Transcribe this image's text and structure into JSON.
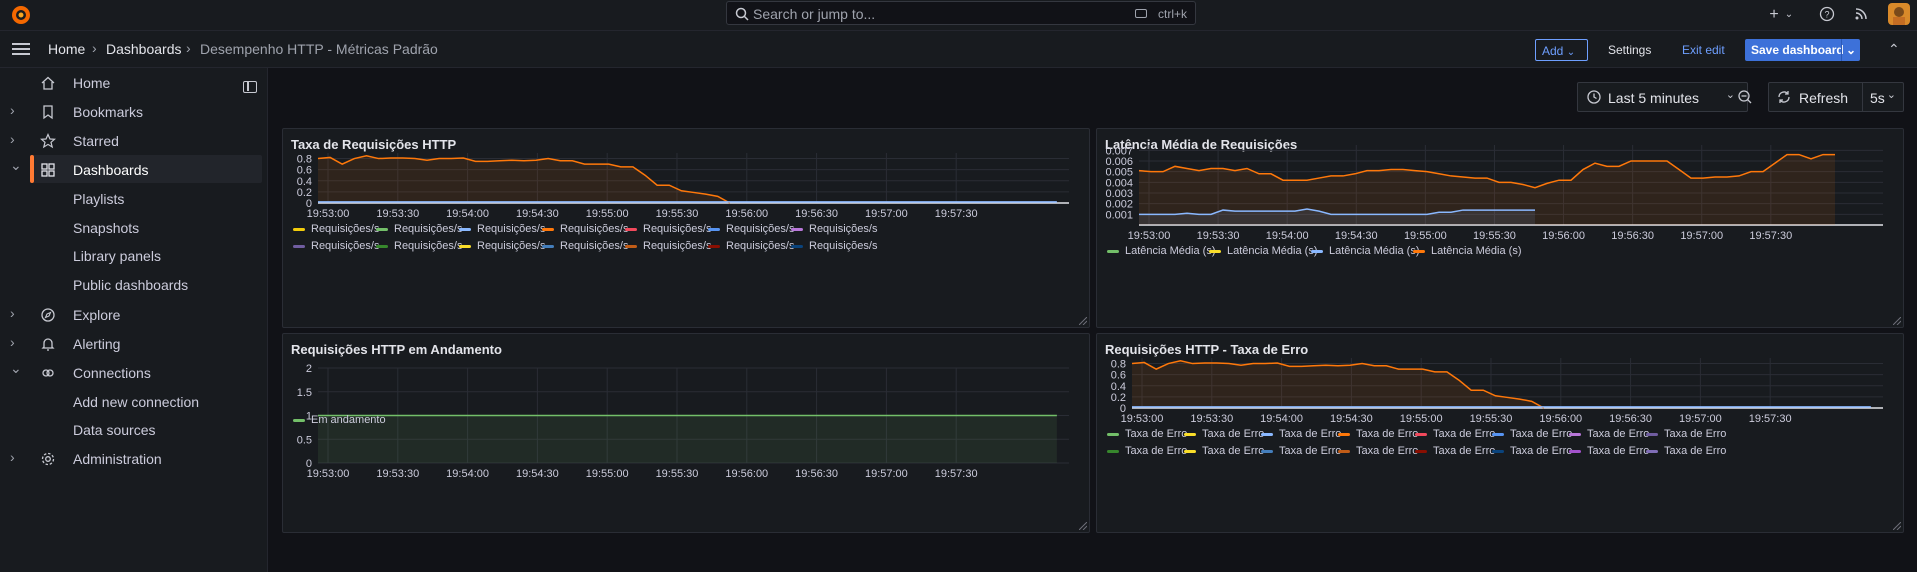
{
  "topbar": {
    "search_placeholder": "Search or jump to...",
    "search_shortcut": "ctrl+k",
    "icons": [
      "plus-icon",
      "help-icon",
      "news-icon",
      "avatar"
    ]
  },
  "breadcrumb": {
    "home": "Home",
    "dashboards": "Dashboards",
    "current": "Desempenho HTTP - Métricas Padrão"
  },
  "toolbar": {
    "add_label": "Add",
    "settings_label": "Settings",
    "exit_edit_label": "Exit edit",
    "save_label": "Save dashboard"
  },
  "sidebar": {
    "items": [
      {
        "label": "Home",
        "icon": "home-icon",
        "chevron": ""
      },
      {
        "label": "Bookmarks",
        "icon": "bookmark-icon",
        "chevron": "›"
      },
      {
        "label": "Starred",
        "icon": "star-icon",
        "chevron": "›"
      },
      {
        "label": "Dashboards",
        "icon": "apps-icon",
        "chevron": "⌄",
        "active": true
      },
      {
        "label": "Playlists",
        "sub": true
      },
      {
        "label": "Snapshots",
        "sub": true
      },
      {
        "label": "Library panels",
        "sub": true
      },
      {
        "label": "Public dashboards",
        "sub": true
      },
      {
        "label": "Explore",
        "icon": "compass-icon",
        "chevron": "›"
      },
      {
        "label": "Alerting",
        "icon": "bell-icon",
        "chevron": "›"
      },
      {
        "label": "Connections",
        "icon": "link-icon",
        "chevron": "⌄"
      },
      {
        "label": "Add new connection",
        "sub": true
      },
      {
        "label": "Data sources",
        "sub": true
      },
      {
        "label": "Administration",
        "icon": "cog-icon",
        "chevron": "›"
      }
    ]
  },
  "controls": {
    "time_range": "Last 5 minutes",
    "refresh_label": "Refresh",
    "refresh_interval": "5s"
  },
  "colors": {
    "orange": "#ff780a",
    "green": "#73bf69",
    "blue": "#8ab8ff",
    "accent": "#3d71d9"
  },
  "panels": {
    "p1": {
      "title": "Taxa de Requisições HTTP"
    },
    "p2": {
      "title": "Latência Média de Requisições"
    },
    "p3": {
      "title": "Requisições HTTP em Andamento"
    },
    "p4": {
      "title": "Requisições HTTP - Taxa de Erro"
    }
  },
  "chart_data": [
    {
      "type": "area",
      "title": "Taxa de Requisições HTTP",
      "x_ticks": [
        "19:53:00",
        "19:53:30",
        "19:54:00",
        "19:54:30",
        "19:55:00",
        "19:55:30",
        "19:56:00",
        "19:56:30",
        "19:57:00",
        "19:57:30"
      ],
      "y_ticks": [
        "0",
        "0.2",
        "0.4",
        "0.6",
        "0.8"
      ],
      "ylim": [
        0,
        0.9
      ],
      "series": [
        {
          "name": "Requisições/s",
          "color": "#ff780a",
          "values": [
            0.8,
            0.82,
            0.7,
            0.8,
            0.85,
            0.8,
            0.81,
            0.81,
            0.8,
            0.77,
            0.8,
            0.8,
            0.81,
            0.75,
            0.75,
            0.76,
            0.77,
            0.76,
            0.77,
            0.8,
            0.76,
            0.76,
            0.7,
            0.7,
            0.7,
            0.65,
            0.65,
            0.5,
            0.32,
            0.32,
            0.22,
            0.19,
            0.16,
            0.12,
            0
          ]
        },
        {
          "name": "Requisições/s",
          "color": "#8ab8ff",
          "values": [
            0.02,
            0.02,
            0.02,
            0.02,
            0.02,
            0.02,
            0.02,
            0.02,
            0.02,
            0.02,
            0.02,
            0.02,
            0.02,
            0.02,
            0.02,
            0.02,
            0.02,
            0.02,
            0.02,
            0.02,
            0.02,
            0.02,
            0.02,
            0.02,
            0.02,
            0.02,
            0.02,
            0.02,
            0.02,
            0.02,
            0.02,
            0.02,
            0.02,
            0.02,
            0.02,
            0.02,
            0.02,
            0.02,
            0.02,
            0.02,
            0.02,
            0.02,
            0.02,
            0.02,
            0.02,
            0.02,
            0.02,
            0.02,
            0.02,
            0.02,
            0.02,
            0.02,
            0.02,
            0.02,
            0.02,
            0.02,
            0.02,
            0.02,
            0.02,
            0.02,
            0.02,
            0.02
          ]
        }
      ],
      "legend": {
        "row1": [
          {
            "name": "Requisições/s",
            "color": "#f2cc0c"
          },
          {
            "name": "Requisições/s",
            "color": "#73bf69"
          },
          {
            "name": "Requisições/s",
            "color": "#8ab8ff"
          },
          {
            "name": "Requisições/s",
            "color": "#ff780a"
          },
          {
            "name": "Requisições/s",
            "color": "#f2495c"
          },
          {
            "name": "Requisições/s",
            "color": "#5794f2"
          },
          {
            "name": "Requisições/s",
            "color": "#b877d9"
          }
        ],
        "row2": [
          {
            "name": "Requisições/s",
            "color": "#705da0"
          },
          {
            "name": "Requisições/s",
            "color": "#37872d"
          },
          {
            "name": "Requisições/s",
            "color": "#fade2a"
          },
          {
            "name": "Requisições/s",
            "color": "#447ebc"
          },
          {
            "name": "Requisições/s",
            "color": "#c15c17"
          },
          {
            "name": "Requisições/s",
            "color": "#890f02"
          },
          {
            "name": "Requisições/s",
            "color": "#0a437c"
          }
        ]
      }
    },
    {
      "type": "area",
      "title": "Latência Média de Requisições",
      "x_ticks": [
        "19:53:00",
        "19:53:30",
        "19:54:00",
        "19:54:30",
        "19:55:00",
        "19:55:30",
        "19:56:00",
        "19:56:30",
        "19:57:00",
        "19:57:30"
      ],
      "y_ticks": [
        "0.001",
        "0.002",
        "0.003",
        "0.004",
        "0.005",
        "0.006",
        "0.007"
      ],
      "ylim": [
        0,
        0.0075
      ],
      "series": [
        {
          "name": "Latência Média (s)",
          "color": "#ff780a",
          "values": [
            0.0051,
            0.005,
            0.005,
            0.0055,
            0.0053,
            0.0051,
            0.0053,
            0.0053,
            0.0051,
            0.0053,
            0.0048,
            0.0048,
            0.0042,
            0.0042,
            0.0042,
            0.0044,
            0.0046,
            0.0046,
            0.0048,
            0.0051,
            0.0051,
            0.0052,
            0.0052,
            0.0051,
            0.005,
            0.0048,
            0.0046,
            0.0045,
            0.0044,
            0.0044,
            0.004,
            0.004,
            0.0038,
            0.0035,
            0.0039,
            0.0042,
            0.0042,
            0.0052,
            0.0058,
            0.0055,
            0.0055,
            0.006,
            0.006,
            0.006,
            0.006,
            0.0052,
            0.0044,
            0.0044,
            0.0045,
            0.0045,
            0.0046,
            0.005,
            0.005,
            0.0058,
            0.0066,
            0.0066,
            0.0062,
            0.0066,
            0.0066
          ]
        },
        {
          "name": "Latência Média (s)",
          "color": "#8ab8ff",
          "values": [
            0.001,
            0.001,
            0.001,
            0.001,
            0.0011,
            0.001,
            0.001,
            0.0014,
            0.0013,
            0.0013,
            0.0013,
            0.0013,
            0.0013,
            0.0013,
            0.0015,
            0.0013,
            0.001,
            0.001,
            0.001,
            0.001,
            0.001,
            0.001,
            0.001,
            0.001,
            0.001,
            0.0012,
            0.0012,
            0.0014,
            0.0014,
            0.0014,
            0.0014,
            0.0014,
            0.0014,
            0.0014
          ]
        }
      ],
      "legend": {
        "row1": [
          {
            "name": "Latência Média (s)",
            "color": "#73bf69"
          },
          {
            "name": "Latência Média (s)",
            "color": "#fade2a"
          },
          {
            "name": "Latência Média (s)",
            "color": "#8ab8ff"
          },
          {
            "name": "Latência Média (s)",
            "color": "#ff780a"
          }
        ]
      }
    },
    {
      "type": "area",
      "title": "Requisições HTTP em Andamento",
      "x_ticks": [
        "19:53:00",
        "19:53:30",
        "19:54:00",
        "19:54:30",
        "19:55:00",
        "19:55:30",
        "19:56:00",
        "19:56:30",
        "19:57:00",
        "19:57:30"
      ],
      "y_ticks": [
        "0",
        "0.5",
        "1",
        "1.5",
        "2"
      ],
      "ylim": [
        0,
        2
      ],
      "series": [
        {
          "name": "Em andamento",
          "color": "#73bf69",
          "values": [
            1,
            1,
            1,
            1,
            1,
            1,
            1,
            1,
            1,
            1,
            1,
            1,
            1,
            1,
            1,
            1,
            1,
            1,
            1,
            1,
            1,
            1,
            1,
            1,
            1,
            1,
            1,
            1,
            1,
            1,
            1,
            1,
            1,
            1,
            1,
            1,
            1,
            1,
            1,
            1,
            1,
            1,
            1,
            1,
            1,
            1,
            1,
            1,
            1,
            1,
            1,
            1,
            1,
            1,
            1,
            1,
            1,
            1,
            1,
            1,
            1,
            1
          ]
        }
      ],
      "legend": {
        "row1": [
          {
            "name": "Em andamento",
            "color": "#73bf69"
          }
        ]
      }
    },
    {
      "type": "area",
      "title": "Requisições HTTP - Taxa de Erro",
      "x_ticks": [
        "19:53:00",
        "19:53:30",
        "19:54:00",
        "19:54:30",
        "19:55:00",
        "19:55:30",
        "19:56:00",
        "19:56:30",
        "19:57:00",
        "19:57:30"
      ],
      "y_ticks": [
        "0",
        "0.2",
        "0.4",
        "0.6",
        "0.8"
      ],
      "ylim": [
        0,
        0.9
      ],
      "series": [
        {
          "name": "Taxa de Erro",
          "color": "#ff780a",
          "values": [
            0.8,
            0.82,
            0.7,
            0.8,
            0.85,
            0.8,
            0.81,
            0.81,
            0.8,
            0.77,
            0.8,
            0.8,
            0.81,
            0.75,
            0.75,
            0.76,
            0.77,
            0.76,
            0.77,
            0.8,
            0.76,
            0.76,
            0.7,
            0.7,
            0.7,
            0.65,
            0.65,
            0.5,
            0.32,
            0.32,
            0.22,
            0.19,
            0.16,
            0.12,
            0
          ]
        },
        {
          "name": "Taxa de Erro",
          "color": "#8ab8ff",
          "values": [
            0.02,
            0.02,
            0.02,
            0.02,
            0.02,
            0.02,
            0.02,
            0.02,
            0.02,
            0.02,
            0.02,
            0.02,
            0.02,
            0.02,
            0.02,
            0.02,
            0.02,
            0.02,
            0.02,
            0.02,
            0.02,
            0.02,
            0.02,
            0.02,
            0.02,
            0.02,
            0.02,
            0.02,
            0.02,
            0.02,
            0.02,
            0.02,
            0.02,
            0.02,
            0.02,
            0.02,
            0.02,
            0.02,
            0.02,
            0.02,
            0.02,
            0.02,
            0.02,
            0.02,
            0.02,
            0.02,
            0.02,
            0.02,
            0.02,
            0.02,
            0.02,
            0.02,
            0.02,
            0.02,
            0.02,
            0.02,
            0.02,
            0.02,
            0.02,
            0.02,
            0.02,
            0.02
          ]
        }
      ],
      "legend": {
        "row1": [
          {
            "name": "Taxa de Erro",
            "color": "#73bf69"
          },
          {
            "name": "Taxa de Erro",
            "color": "#fade2a"
          },
          {
            "name": "Taxa de Erro",
            "color": "#8ab8ff"
          },
          {
            "name": "Taxa de Erro",
            "color": "#ff780a"
          },
          {
            "name": "Taxa de Erro",
            "color": "#f2495c"
          },
          {
            "name": "Taxa de Erro",
            "color": "#5794f2"
          },
          {
            "name": "Taxa de Erro",
            "color": "#b877d9"
          },
          {
            "name": "Taxa de Erro",
            "color": "#705da0"
          }
        ],
        "row2": [
          {
            "name": "Taxa de Erro",
            "color": "#37872d"
          },
          {
            "name": "Taxa de Erro",
            "color": "#fade2a"
          },
          {
            "name": "Taxa de Erro",
            "color": "#447ebc"
          },
          {
            "name": "Taxa de Erro",
            "color": "#c15c17"
          },
          {
            "name": "Taxa de Erro",
            "color": "#890f02"
          },
          {
            "name": "Taxa de Erro",
            "color": "#0a437c"
          },
          {
            "name": "Taxa de Erro",
            "color": "#a352cc"
          },
          {
            "name": "Taxa de Erro",
            "color": "#806eb7"
          }
        ]
      }
    }
  ]
}
